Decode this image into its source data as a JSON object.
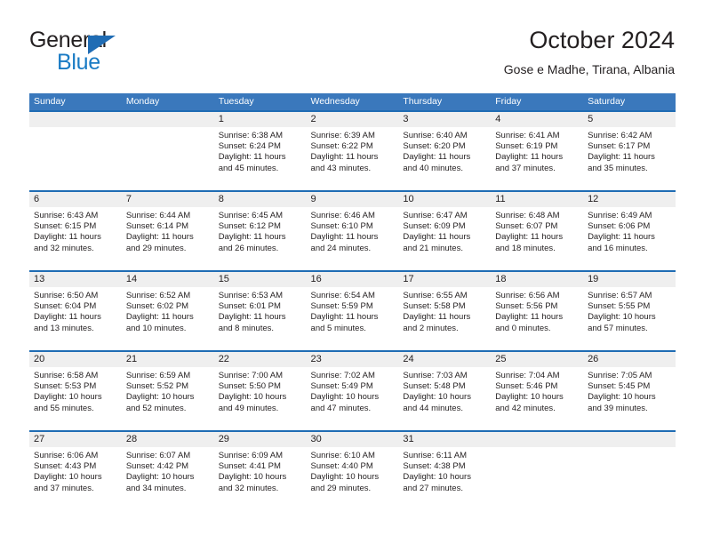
{
  "brand": {
    "name_part1": "General",
    "name_part2": "Blue",
    "logo_icon": "triangle-logo-icon"
  },
  "header": {
    "title": "October 2024",
    "subtitle": "Gose e Madhe, Tirana, Albania"
  },
  "colors": {
    "header_blue": "#3a78bc",
    "rule_blue": "#1f6cb4",
    "daynum_band": "#efefef",
    "brand_blue": "#1a7bc4",
    "text": "#231f20"
  },
  "weekdays": [
    "Sunday",
    "Monday",
    "Tuesday",
    "Wednesday",
    "Thursday",
    "Friday",
    "Saturday"
  ],
  "weeks": [
    [
      {
        "empty": true
      },
      {
        "empty": true
      },
      {
        "day": "1",
        "sunrise": "Sunrise: 6:38 AM",
        "sunset": "Sunset: 6:24 PM",
        "daylight1": "Daylight: 11 hours",
        "daylight2": "and 45 minutes."
      },
      {
        "day": "2",
        "sunrise": "Sunrise: 6:39 AM",
        "sunset": "Sunset: 6:22 PM",
        "daylight1": "Daylight: 11 hours",
        "daylight2": "and 43 minutes."
      },
      {
        "day": "3",
        "sunrise": "Sunrise: 6:40 AM",
        "sunset": "Sunset: 6:20 PM",
        "daylight1": "Daylight: 11 hours",
        "daylight2": "and 40 minutes."
      },
      {
        "day": "4",
        "sunrise": "Sunrise: 6:41 AM",
        "sunset": "Sunset: 6:19 PM",
        "daylight1": "Daylight: 11 hours",
        "daylight2": "and 37 minutes."
      },
      {
        "day": "5",
        "sunrise": "Sunrise: 6:42 AM",
        "sunset": "Sunset: 6:17 PM",
        "daylight1": "Daylight: 11 hours",
        "daylight2": "and 35 minutes."
      }
    ],
    [
      {
        "day": "6",
        "sunrise": "Sunrise: 6:43 AM",
        "sunset": "Sunset: 6:15 PM",
        "daylight1": "Daylight: 11 hours",
        "daylight2": "and 32 minutes."
      },
      {
        "day": "7",
        "sunrise": "Sunrise: 6:44 AM",
        "sunset": "Sunset: 6:14 PM",
        "daylight1": "Daylight: 11 hours",
        "daylight2": "and 29 minutes."
      },
      {
        "day": "8",
        "sunrise": "Sunrise: 6:45 AM",
        "sunset": "Sunset: 6:12 PM",
        "daylight1": "Daylight: 11 hours",
        "daylight2": "and 26 minutes."
      },
      {
        "day": "9",
        "sunrise": "Sunrise: 6:46 AM",
        "sunset": "Sunset: 6:10 PM",
        "daylight1": "Daylight: 11 hours",
        "daylight2": "and 24 minutes."
      },
      {
        "day": "10",
        "sunrise": "Sunrise: 6:47 AM",
        "sunset": "Sunset: 6:09 PM",
        "daylight1": "Daylight: 11 hours",
        "daylight2": "and 21 minutes."
      },
      {
        "day": "11",
        "sunrise": "Sunrise: 6:48 AM",
        "sunset": "Sunset: 6:07 PM",
        "daylight1": "Daylight: 11 hours",
        "daylight2": "and 18 minutes."
      },
      {
        "day": "12",
        "sunrise": "Sunrise: 6:49 AM",
        "sunset": "Sunset: 6:06 PM",
        "daylight1": "Daylight: 11 hours",
        "daylight2": "and 16 minutes."
      }
    ],
    [
      {
        "day": "13",
        "sunrise": "Sunrise: 6:50 AM",
        "sunset": "Sunset: 6:04 PM",
        "daylight1": "Daylight: 11 hours",
        "daylight2": "and 13 minutes."
      },
      {
        "day": "14",
        "sunrise": "Sunrise: 6:52 AM",
        "sunset": "Sunset: 6:02 PM",
        "daylight1": "Daylight: 11 hours",
        "daylight2": "and 10 minutes."
      },
      {
        "day": "15",
        "sunrise": "Sunrise: 6:53 AM",
        "sunset": "Sunset: 6:01 PM",
        "daylight1": "Daylight: 11 hours",
        "daylight2": "and 8 minutes."
      },
      {
        "day": "16",
        "sunrise": "Sunrise: 6:54 AM",
        "sunset": "Sunset: 5:59 PM",
        "daylight1": "Daylight: 11 hours",
        "daylight2": "and 5 minutes."
      },
      {
        "day": "17",
        "sunrise": "Sunrise: 6:55 AM",
        "sunset": "Sunset: 5:58 PM",
        "daylight1": "Daylight: 11 hours",
        "daylight2": "and 2 minutes."
      },
      {
        "day": "18",
        "sunrise": "Sunrise: 6:56 AM",
        "sunset": "Sunset: 5:56 PM",
        "daylight1": "Daylight: 11 hours",
        "daylight2": "and 0 minutes."
      },
      {
        "day": "19",
        "sunrise": "Sunrise: 6:57 AM",
        "sunset": "Sunset: 5:55 PM",
        "daylight1": "Daylight: 10 hours",
        "daylight2": "and 57 minutes."
      }
    ],
    [
      {
        "day": "20",
        "sunrise": "Sunrise: 6:58 AM",
        "sunset": "Sunset: 5:53 PM",
        "daylight1": "Daylight: 10 hours",
        "daylight2": "and 55 minutes."
      },
      {
        "day": "21",
        "sunrise": "Sunrise: 6:59 AM",
        "sunset": "Sunset: 5:52 PM",
        "daylight1": "Daylight: 10 hours",
        "daylight2": "and 52 minutes."
      },
      {
        "day": "22",
        "sunrise": "Sunrise: 7:00 AM",
        "sunset": "Sunset: 5:50 PM",
        "daylight1": "Daylight: 10 hours",
        "daylight2": "and 49 minutes."
      },
      {
        "day": "23",
        "sunrise": "Sunrise: 7:02 AM",
        "sunset": "Sunset: 5:49 PM",
        "daylight1": "Daylight: 10 hours",
        "daylight2": "and 47 minutes."
      },
      {
        "day": "24",
        "sunrise": "Sunrise: 7:03 AM",
        "sunset": "Sunset: 5:48 PM",
        "daylight1": "Daylight: 10 hours",
        "daylight2": "and 44 minutes."
      },
      {
        "day": "25",
        "sunrise": "Sunrise: 7:04 AM",
        "sunset": "Sunset: 5:46 PM",
        "daylight1": "Daylight: 10 hours",
        "daylight2": "and 42 minutes."
      },
      {
        "day": "26",
        "sunrise": "Sunrise: 7:05 AM",
        "sunset": "Sunset: 5:45 PM",
        "daylight1": "Daylight: 10 hours",
        "daylight2": "and 39 minutes."
      }
    ],
    [
      {
        "day": "27",
        "sunrise": "Sunrise: 6:06 AM",
        "sunset": "Sunset: 4:43 PM",
        "daylight1": "Daylight: 10 hours",
        "daylight2": "and 37 minutes."
      },
      {
        "day": "28",
        "sunrise": "Sunrise: 6:07 AM",
        "sunset": "Sunset: 4:42 PM",
        "daylight1": "Daylight: 10 hours",
        "daylight2": "and 34 minutes."
      },
      {
        "day": "29",
        "sunrise": "Sunrise: 6:09 AM",
        "sunset": "Sunset: 4:41 PM",
        "daylight1": "Daylight: 10 hours",
        "daylight2": "and 32 minutes."
      },
      {
        "day": "30",
        "sunrise": "Sunrise: 6:10 AM",
        "sunset": "Sunset: 4:40 PM",
        "daylight1": "Daylight: 10 hours",
        "daylight2": "and 29 minutes."
      },
      {
        "day": "31",
        "sunrise": "Sunrise: 6:11 AM",
        "sunset": "Sunset: 4:38 PM",
        "daylight1": "Daylight: 10 hours",
        "daylight2": "and 27 minutes."
      },
      {
        "empty": true
      },
      {
        "empty": true
      }
    ]
  ]
}
